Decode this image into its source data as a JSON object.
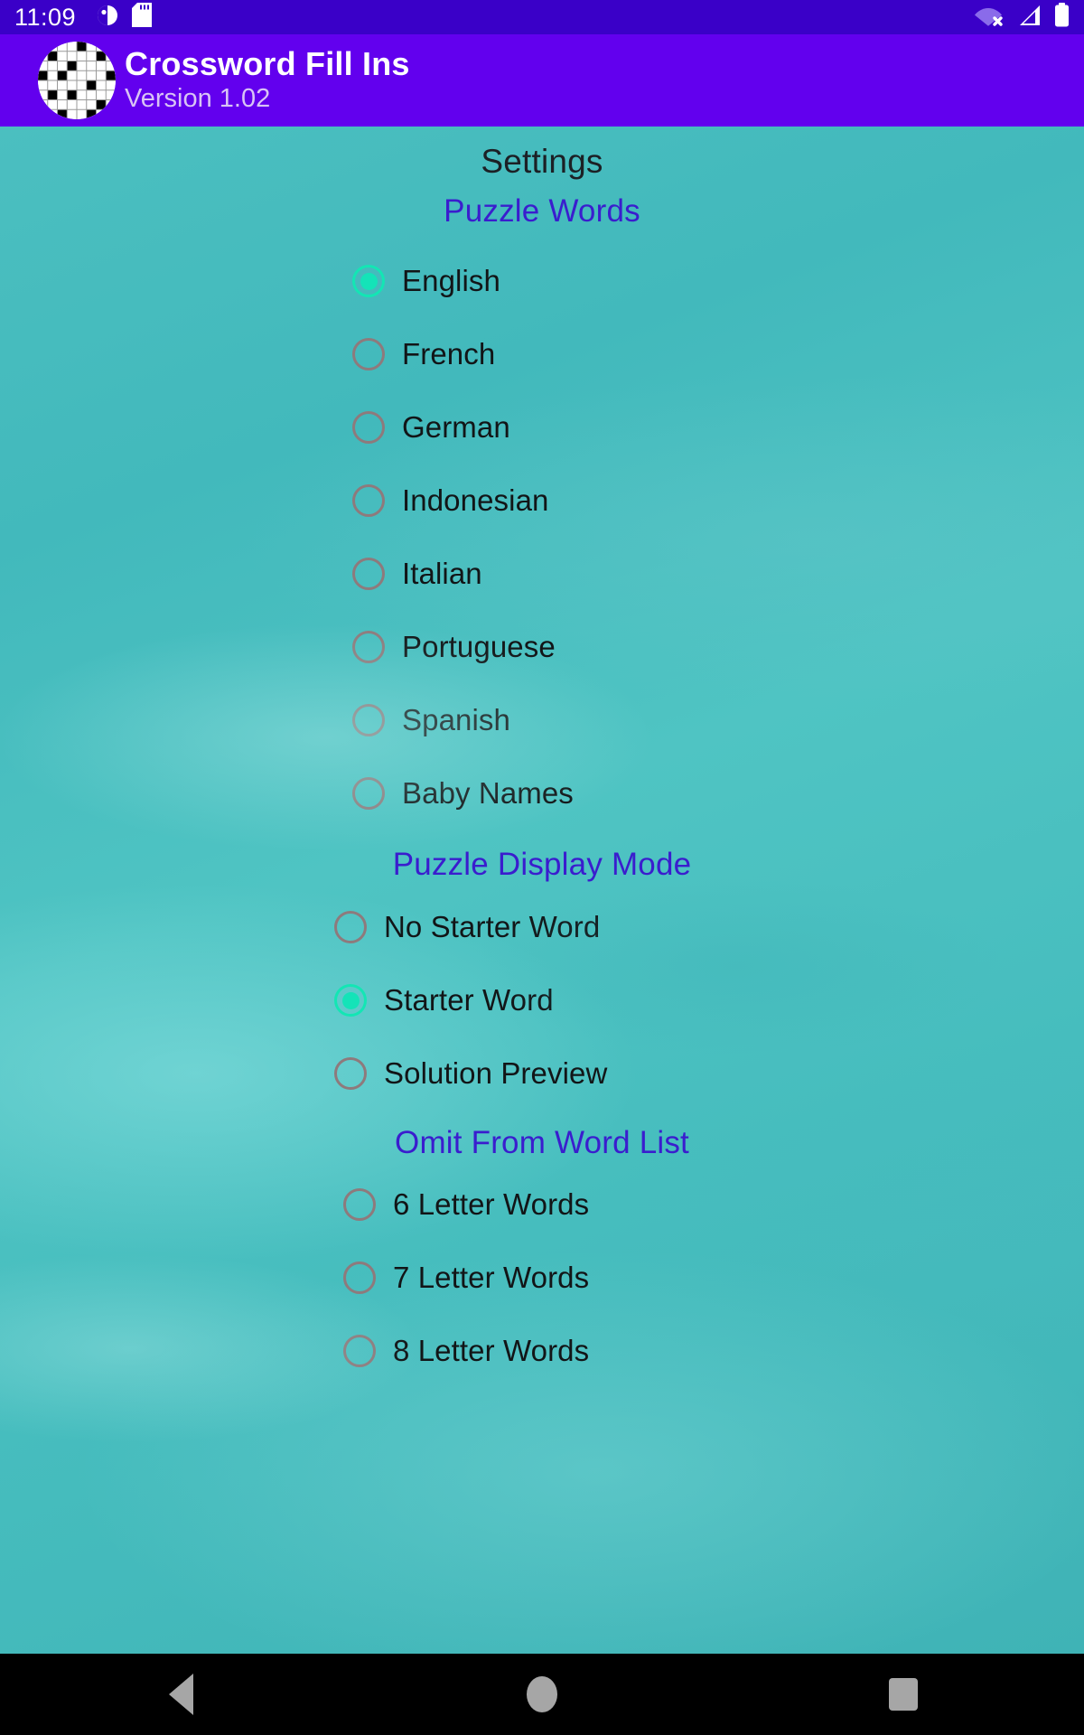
{
  "status_bar": {
    "time": "11:09",
    "left_icons": [
      "do-not-disturb-icon",
      "sd-card-icon"
    ],
    "right_icons": [
      "wifi-off-icon",
      "cellular-signal-icon",
      "battery-full-icon"
    ],
    "background_color": "#3A00C8"
  },
  "app_bar": {
    "title": "Crossword Fill Ins",
    "version": "Version 1.02",
    "logo_icon": "crossword-grid-icon",
    "background_color": "#6200EE"
  },
  "page": {
    "title": "Settings",
    "heading_color": "#3A1DCE",
    "selected_radio_color": "#14E3B8",
    "unselected_radio_color": "#8E7A7C"
  },
  "sections": [
    {
      "heading": "Puzzle Words",
      "name": "puzzle-words",
      "options": [
        {
          "label": "English",
          "selected": true
        },
        {
          "label": "French",
          "selected": false
        },
        {
          "label": "German",
          "selected": false
        },
        {
          "label": "Indonesian",
          "selected": false
        },
        {
          "label": "Italian",
          "selected": false
        },
        {
          "label": "Portuguese",
          "selected": false
        },
        {
          "label": "Spanish",
          "selected": false
        },
        {
          "label": "Baby Names",
          "selected": false
        }
      ]
    },
    {
      "heading": "Puzzle Display Mode",
      "name": "puzzle-display-mode",
      "options": [
        {
          "label": "No Starter Word",
          "selected": false
        },
        {
          "label": "Starter Word",
          "selected": true
        },
        {
          "label": "Solution Preview",
          "selected": false
        }
      ]
    },
    {
      "heading": "Omit From Word List",
      "name": "omit-from-word-list",
      "options": [
        {
          "label": "6 Letter Words",
          "selected": false
        },
        {
          "label": "7 Letter Words",
          "selected": false
        },
        {
          "label": "8 Letter Words",
          "selected": false
        }
      ]
    }
  ],
  "nav_bar": {
    "buttons": [
      {
        "name": "back-button",
        "icon": "triangle-back-icon"
      },
      {
        "name": "home-button",
        "icon": "circle-home-icon"
      },
      {
        "name": "recents-button",
        "icon": "square-recents-icon"
      }
    ]
  }
}
